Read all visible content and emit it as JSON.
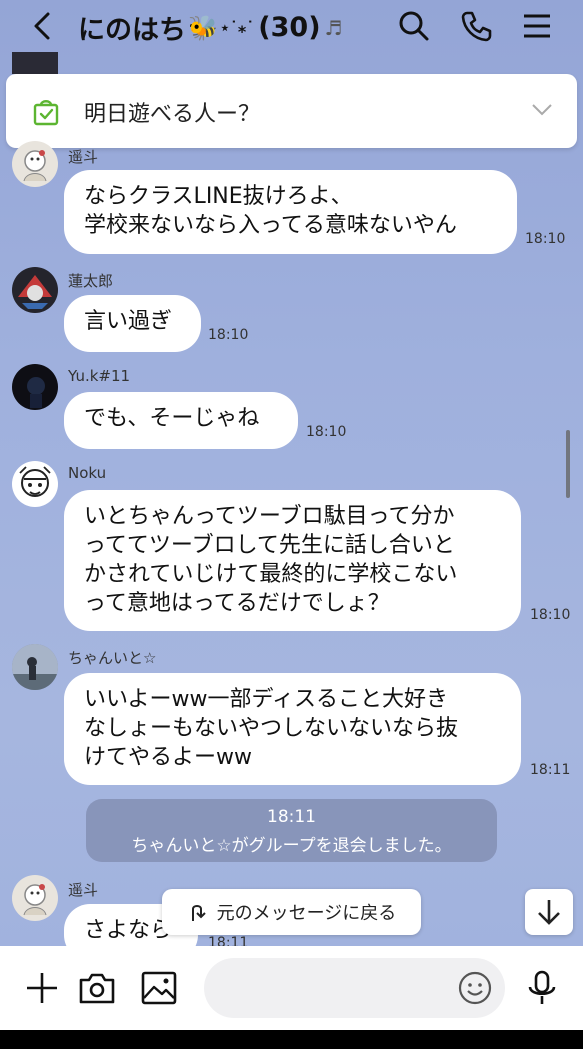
{
  "header": {
    "title": "にのはち",
    "title_deco": "🐝",
    "title_sparkle": "⋆˙⁎˙",
    "member_count": "(30)",
    "title_note": "♬"
  },
  "pinned": {
    "text": "明日遊べる人ー？"
  },
  "messages": [
    {
      "sender": "遥斗",
      "lines": [
        "ならクラスLINE抜けろよ、",
        "学校来ないなら入ってる意味ないやん"
      ],
      "time": "18:10"
    },
    {
      "sender": "蓮太郎",
      "lines": [
        "言い過ぎ"
      ],
      "time": "18:10"
    },
    {
      "sender": "Yu.k#11",
      "lines": [
        "でも、そーじゃね"
      ],
      "time": "18:10"
    },
    {
      "sender": "Noku",
      "lines": [
        "いとちゃんってツーブロ駄目って分か",
        "っててツーブロして先生に話し合いと",
        "かされていじけて最終的に学校こない",
        "って意地はってるだけでしょ？"
      ],
      "time": "18:10"
    },
    {
      "sender": "ちゃんいと☆",
      "lines": [
        "いいよーww一部ディスること大好き",
        "なしょーもないやつしないないなら抜",
        "けてやるよーww"
      ],
      "time": "18:11"
    },
    {
      "sender": "遥斗",
      "lines": [
        "さよなら"
      ],
      "time": "18:11"
    }
  ],
  "notice": {
    "time": "18:11",
    "text": "ちゃんいと☆がグループを退会しました。"
  },
  "floating": {
    "back_to_message": "元のメッセージに戻る"
  },
  "input": {
    "placeholder": ""
  },
  "colors": {
    "background": "#9fb0dd",
    "bubble": "#ffffff",
    "pin_accent": "#5cb531"
  }
}
